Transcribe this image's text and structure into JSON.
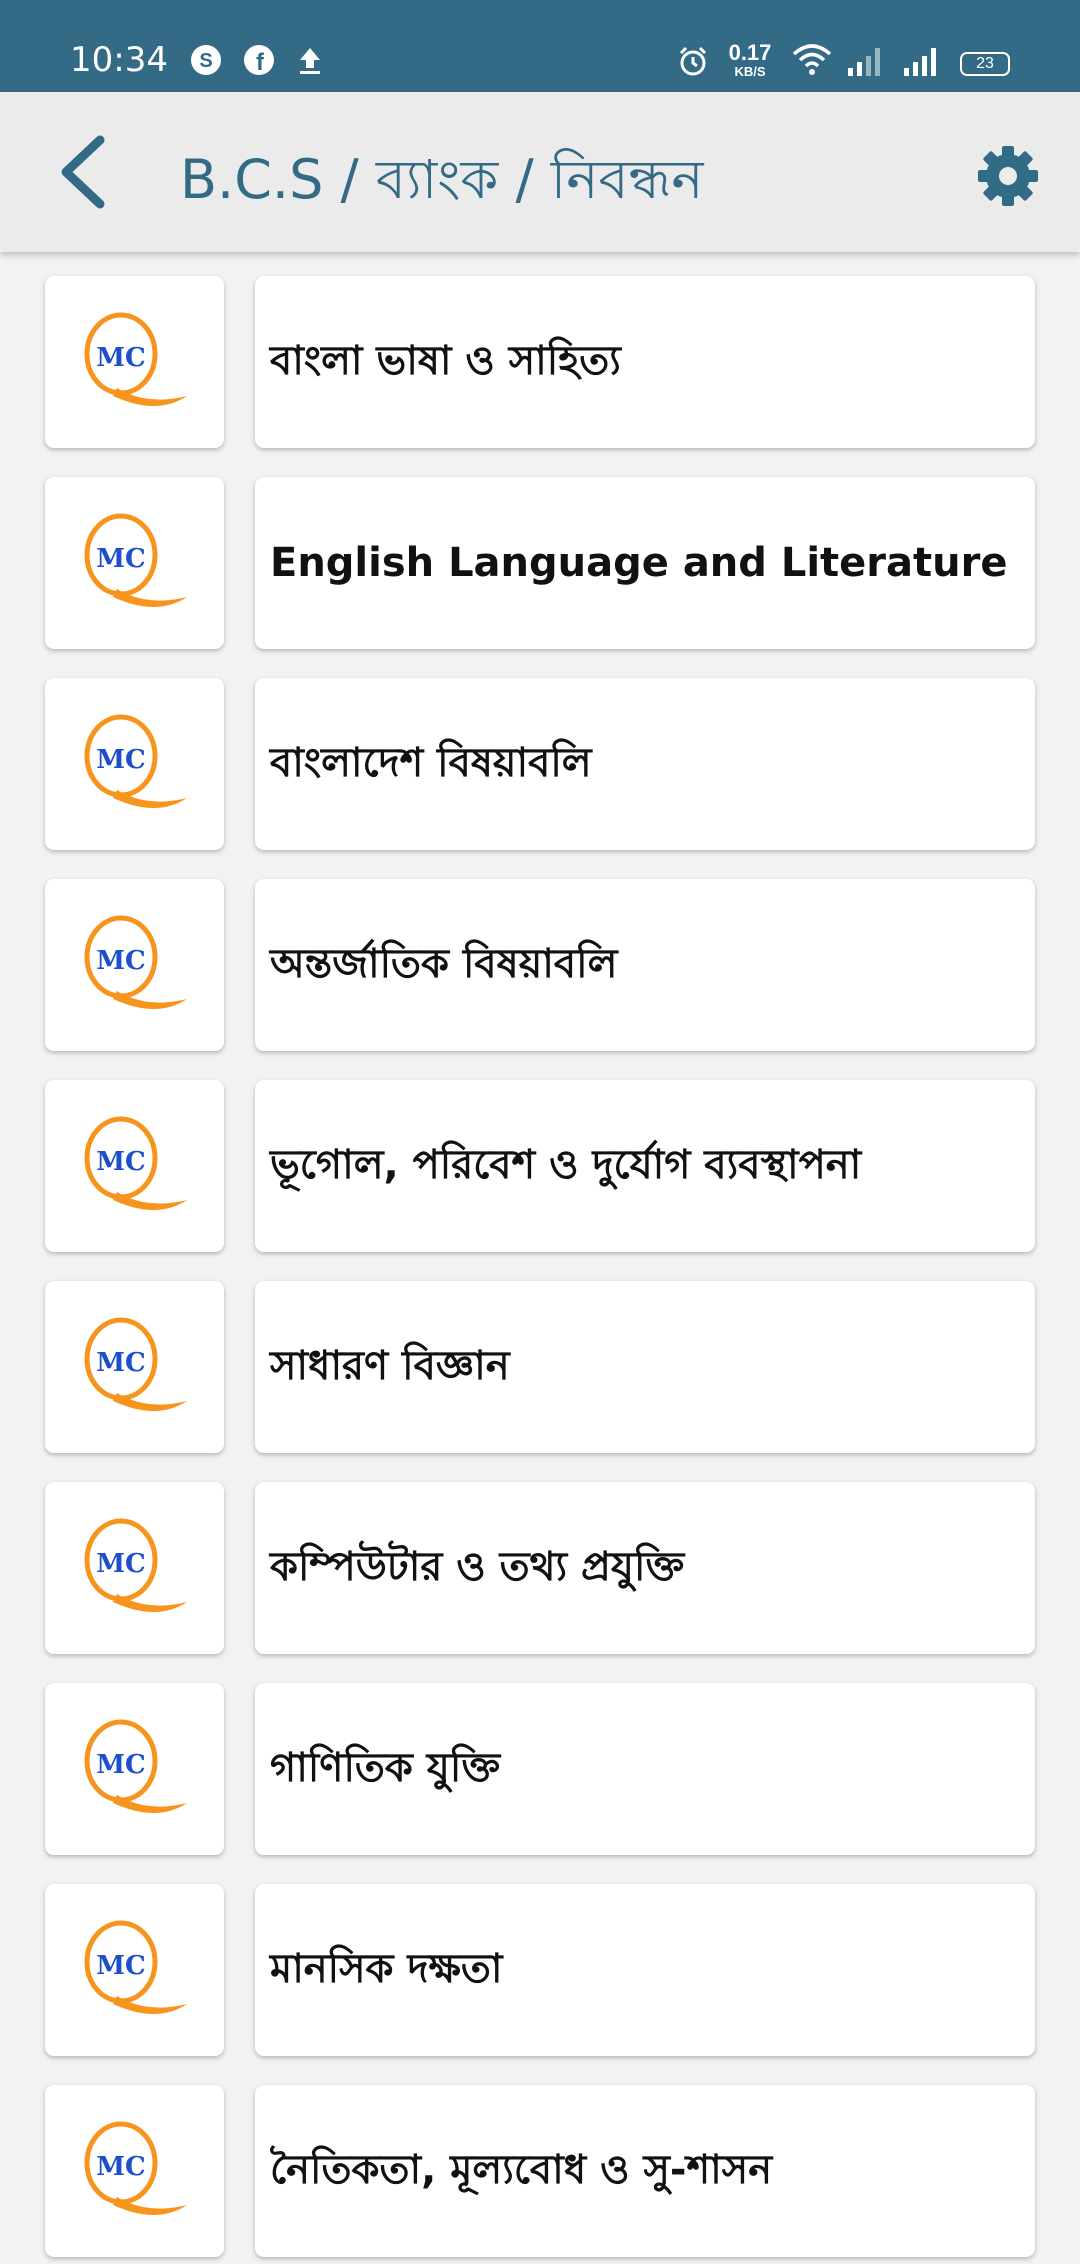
{
  "status_bar": {
    "time": "10:34",
    "left_icons": [
      "skype-icon",
      "facebook-icon",
      "upload-icon"
    ],
    "net_speed_value": "0.17",
    "net_speed_unit": "KB/S",
    "battery": "23",
    "color": "#336a85"
  },
  "app_bar": {
    "title": "B.C.S / ব্যাংক / নিবন্ধন",
    "back_icon": "chevron-left-icon",
    "settings_icon": "gear-icon",
    "accent_color": "#336a85"
  },
  "logo": {
    "letters": "MC",
    "ring_color": "#f7941d",
    "letters_color": "#1c4fc9"
  },
  "subjects": [
    "বাংলা ভাষা ও সাহিত্য",
    "English Language and Literature",
    "বাংলাদেশ বিষয়াবলি",
    "অন্তর্জাতিক বিষয়াবলি",
    "ভূগোল, পরিবেশ ও দুর্যোগ ব্যবস্থাপনা",
    "সাধারণ বিজ্ঞান",
    "কম্পিউটার ও তথ্য প্রযুক্তি",
    "গাণিতিক যুক্তি",
    "মানসিক দক্ষতা",
    "নৈতিকতা, মূল্যবোধ ও সু-শাসন"
  ]
}
